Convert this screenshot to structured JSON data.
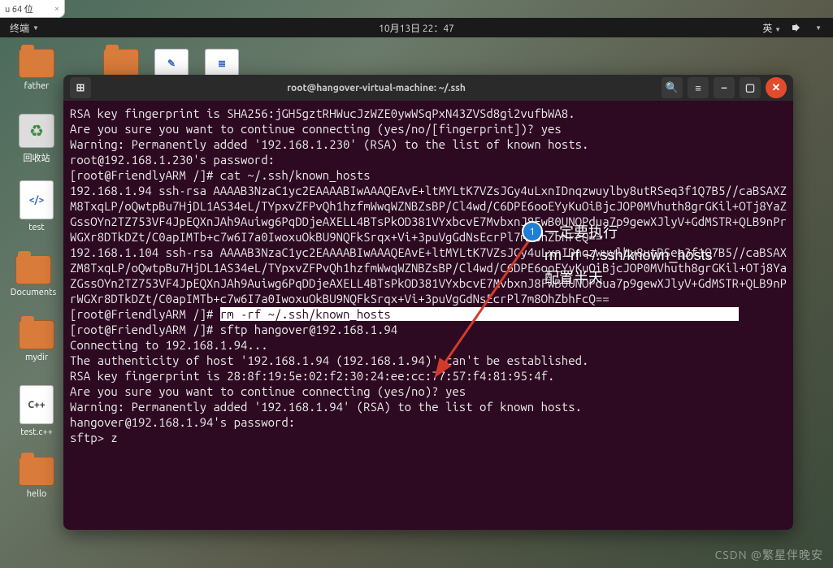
{
  "chrome_tab": {
    "label": "u 64 位"
  },
  "topbar": {
    "left_label": "终端",
    "datetime": "10月13日 22：47",
    "lang": "英"
  },
  "desktop_icons": [
    {
      "name": "father",
      "kind": "folder"
    },
    {
      "name": "回收站",
      "kind": "recycle"
    },
    {
      "name": "test",
      "kind": "file"
    },
    {
      "name": "Documents",
      "kind": "folder"
    },
    {
      "name": "mydir",
      "kind": "folder"
    },
    {
      "name": "test.c++",
      "kind": "file-cpp",
      "badge": "C++"
    },
    {
      "name": "hello",
      "kind": "folder"
    }
  ],
  "terminal": {
    "title": "root@hangover-virtual-machine: ~/.ssh",
    "lines": [
      "RSA key fingerprint is SHA256:jGH5gztRHWucJzWZE0ywWSqPxN43ZVSd8gi2vufbWA8.",
      "Are you sure you want to continue connecting (yes/no/[fingerprint])? yes",
      "Warning: Permanently added '192.168.1.230' (RSA) to the list of known hosts.",
      "root@192.168.1.230's password: ",
      "[root@FriendlyARM /]# cat ~/.ssh/known_hosts",
      "192.168.1.94 ssh-rsa AAAAB3NzaC1yc2EAAAABIwAAAQEAvE+ltMYLtK7VZsJGy4uLxnIDnqzwuylby8utRSeq3f1Q7B5//caBSAXZM8TxqLP/oQwtpBu7HjDL1AS34eL/TYpxvZFPvQh1hzfmWwqWZNBZsBP/Cl4wd/C6DPE6ooEYyKuOiBjcJOP0MVhuth8grGKil+OTj8YaZGssOYn2TZ753VF4JpEQXnJAh9Auiwg6PqDDjeAXELL4BTsPkOD381VYxbcvE7MvbxnJ8FwB0UNOPdua7p9gewXJlyV+GdMSTR+QLB9nPrWGXr8DTkDZt/C0apIMTb+c7w6I7a0IwoxuOkBU9NQFkSrqx+Vi+3puVgGdNsEcrPl7m8OhZbhFcQ==",
      "192.168.1.104 ssh-rsa AAAAB3NzaC1yc2EAAAABIwAAAQEAvE+ltMYLtK7VZsJGy4uLxnIDnqzwuylby8utRSeq3f1Q7B5//caBSAXZM8TxqLP/oQwtpBu7HjDL1AS34eL/TYpxvZFPvQh1hzfmWwqWZNBZsBP/Cl4wd/C6DPE6ooEYyKuOiBjcJOP0MVhuth8grGKil+OTj8YaZGssOYn2TZ753VF4JpEQXnJAh9Auiwg6PqDDjeAXELL4BTsPkOD381VYxbcvE7MvbxnJ8FwB0UNOPdua7p9gewXJlyV+GdMSTR+QLB9nPrWGXr8DTkDZt/C0apIMTb+c7w6I7a0IwoxuOkBU9NQFkSrqx+Vi+3puVgGdNsEcrPl7m8OhZbhFcQ=="
    ],
    "highlighted_prompt": "[root@FriendlyARM /]# ",
    "highlighted_cmd": "rm -rf ~/.ssh/known_hosts",
    "lines2": [
      "[root@FriendlyARM /]# sftp hangover@192.168.1.94",
      "Connecting to 192.168.1.94...",
      "The authenticity of host '192.168.1.94 (192.168.1.94)' can't be established.",
      "RSA key fingerprint is 28:8f:19:5e:02:f2:30:24:ee:cc:77:57:f4:81:95:4f.",
      "Are you sure you want to continue connecting (yes/no)? yes",
      "Warning: Permanently added '192.168.1.94' (RSA) to the list of known hosts.",
      "hangover@192.168.1.94's password: ",
      "sftp> z"
    ]
  },
  "annotation": {
    "badge": "1",
    "line1": "一定要执行",
    "line2": "rm -rf ~/.ssh/known_hosts",
    "line3": "配置半天"
  },
  "watermark": "CSDN @繁星伴晚安"
}
